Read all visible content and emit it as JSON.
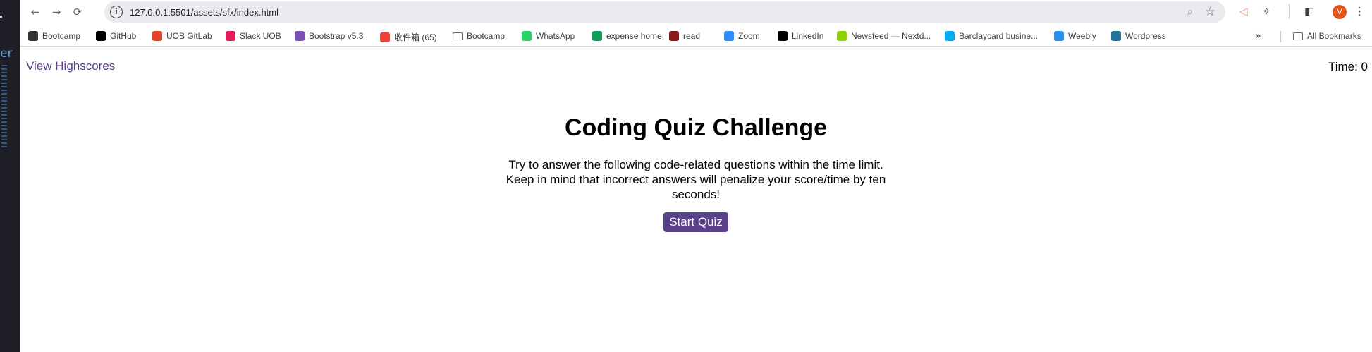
{
  "browser": {
    "url": "127.0.0.1:5501/assets/sfx/index.html",
    "avatar_letter": "V",
    "bookmarks": [
      {
        "label": "Bootcamp",
        "icon": "bootcamp-favicon",
        "color": "#333333"
      },
      {
        "label": "GitHub",
        "icon": "github-icon",
        "color": "#000000"
      },
      {
        "label": "UOB GitLab",
        "icon": "gitlab-icon",
        "color": "#e24329"
      },
      {
        "label": "Slack UOB",
        "icon": "slack-icon",
        "color": "#e01e5a"
      },
      {
        "label": "Bootstrap v5.3",
        "icon": "bootstrap-icon",
        "color": "#7952b3"
      },
      {
        "label": "收件箱 (65)",
        "icon": "gmail-icon",
        "color": "#ea4335"
      },
      {
        "label": "Bootcamp",
        "icon": "folder-icon",
        "color": "#5f6368"
      },
      {
        "label": "WhatsApp",
        "icon": "whatsapp-icon",
        "color": "#25d366"
      },
      {
        "label": "expense home",
        "icon": "sheets-icon",
        "color": "#0f9d58"
      },
      {
        "label": "read",
        "icon": "read-icon",
        "color": "#8b1a1a"
      },
      {
        "label": "Zoom",
        "icon": "zoom-icon",
        "color": "#2d8cff"
      },
      {
        "label": "LinkedIn",
        "icon": "linkedin-icon",
        "color": "#000000"
      },
      {
        "label": "Newsfeed — Nextd...",
        "icon": "nextdoor-icon",
        "color": "#8ed500"
      },
      {
        "label": "Barclaycard busine...",
        "icon": "barclaycard-icon",
        "color": "#00aeef"
      },
      {
        "label": "Weebly",
        "icon": "weebly-icon",
        "color": "#2990ea"
      },
      {
        "label": "Wordpress",
        "icon": "wordpress-icon",
        "color": "#21759b"
      }
    ],
    "all_bookmarks_label": "All Bookmarks"
  },
  "side_strip_text": "er",
  "page": {
    "highscores_link": "View Highscores",
    "timer_label": "Time: ",
    "timer_value": "0",
    "title": "Coding Quiz Challenge",
    "description": "Try to answer the following code-related questions within the time limit. Keep in mind that incorrect answers will penalize your score/time by ten seconds!",
    "start_button": "Start Quiz"
  },
  "colors": {
    "accent": "#5a3f8a"
  }
}
